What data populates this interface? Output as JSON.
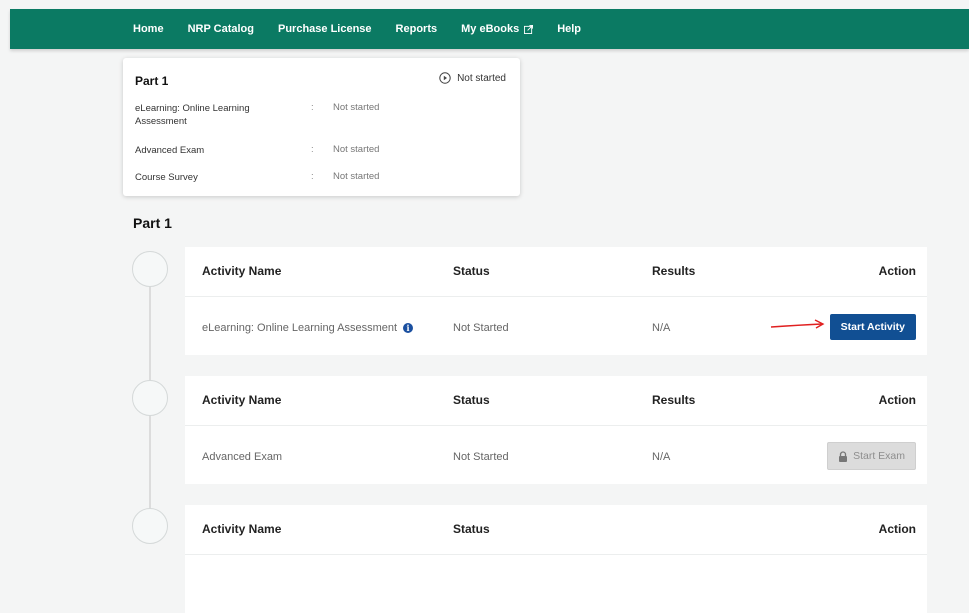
{
  "nav": {
    "items": [
      {
        "label": "Home"
      },
      {
        "label": "NRP Catalog"
      },
      {
        "label": "Purchase License"
      },
      {
        "label": "Reports"
      },
      {
        "label": "My eBooks"
      },
      {
        "label": "Help"
      }
    ]
  },
  "summary": {
    "title": "Part 1",
    "status": "Not started",
    "separator": ":",
    "rows": [
      {
        "name": "eLearning: Online Learning Assessment",
        "status": "Not started"
      },
      {
        "name": "Advanced Exam",
        "status": "Not started"
      },
      {
        "name": "Course Survey",
        "status": "Not started"
      }
    ]
  },
  "section": {
    "title": "Part 1"
  },
  "activities": [
    {
      "headers": {
        "name": "Activity Name",
        "status": "Status",
        "results": "Results",
        "action": "Action"
      },
      "name": "eLearning: Online Learning Assessment",
      "status": "Not Started",
      "results": "N/A",
      "button_label": "Start Activity",
      "button_enabled": true
    },
    {
      "headers": {
        "name": "Activity Name",
        "status": "Status",
        "results": "Results",
        "action": "Action"
      },
      "name": "Advanced Exam",
      "status": "Not Started",
      "results": "N/A",
      "button_label": "Start Exam",
      "button_enabled": false
    },
    {
      "headers": {
        "name": "Activity Name",
        "status": "Status",
        "results": "",
        "action": "Action"
      }
    }
  ],
  "colors": {
    "nav_bg": "#0b7a63",
    "primary_button": "#114f93",
    "annotation_arrow": "#e02020"
  },
  "icons": [
    "external-link-icon",
    "play-circle-icon",
    "info-icon",
    "lock-icon",
    "red-arrow-annotation"
  ]
}
